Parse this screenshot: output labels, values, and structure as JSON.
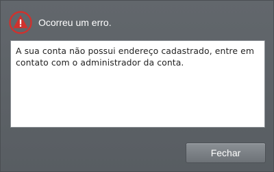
{
  "dialog": {
    "title": "Ocorreu um erro.",
    "icon": "warning-icon",
    "message": "A sua conta não possui endereço cadastrado, entre em contato com o administrador da conta.",
    "close_label": "Fechar"
  },
  "colors": {
    "background": "#5b6065",
    "icon_red": "#d0312d",
    "button_top": "#8b9095",
    "button_bottom": "#6d7277"
  }
}
